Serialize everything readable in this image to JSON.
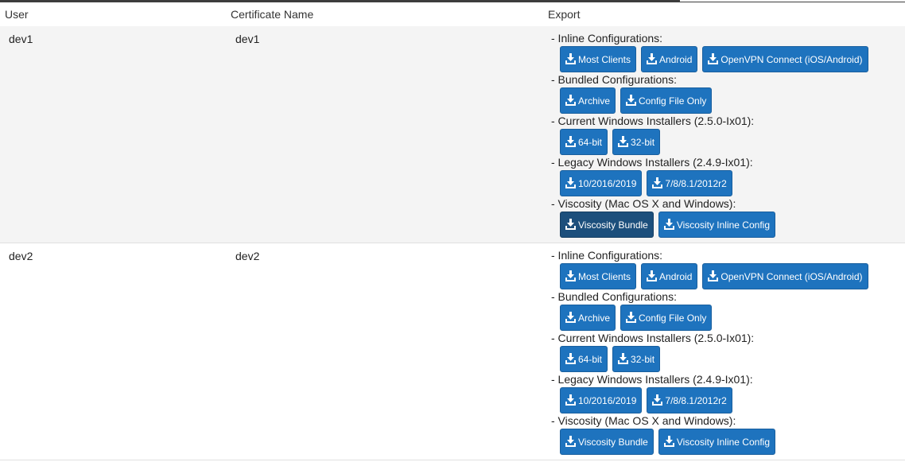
{
  "table": {
    "headers": {
      "user": "User",
      "certificate": "Certificate Name",
      "export": "Export"
    },
    "rows": [
      {
        "user": "dev1",
        "certificate": "dev1",
        "sections": [
          {
            "label": "- Inline Configurations:",
            "buttons": [
              "Most Clients",
              "Android",
              "OpenVPN Connect (iOS/Android)"
            ]
          },
          {
            "label": "- Bundled Configurations:",
            "buttons": [
              "Archive",
              "Config File Only"
            ]
          },
          {
            "label": "- Current Windows Installers (2.5.0-Ix01):",
            "buttons": [
              "64-bit",
              "32-bit"
            ]
          },
          {
            "label": "- Legacy Windows Installers (2.4.9-Ix01):",
            "buttons": [
              "10/2016/2019",
              "7/8/8.1/2012r2"
            ]
          },
          {
            "label": "- Viscosity (Mac OS X and Windows):",
            "buttons": [
              "Viscosity Bundle",
              "Viscosity Inline Config"
            ]
          }
        ]
      },
      {
        "user": "dev2",
        "certificate": "dev2",
        "sections": [
          {
            "label": "- Inline Configurations:",
            "buttons": [
              "Most Clients",
              "Android",
              "OpenVPN Connect (iOS/Android)"
            ]
          },
          {
            "label": "- Bundled Configurations:",
            "buttons": [
              "Archive",
              "Config File Only"
            ]
          },
          {
            "label": "- Current Windows Installers (2.5.0-Ix01):",
            "buttons": [
              "64-bit",
              "32-bit"
            ]
          },
          {
            "label": "- Legacy Windows Installers (2.4.9-Ix01):",
            "buttons": [
              "10/2016/2019",
              "7/8/8.1/2012r2"
            ]
          },
          {
            "label": "- Viscosity (Mac OS X and Windows):",
            "buttons": [
              "Viscosity Bundle",
              "Viscosity Inline Config"
            ]
          }
        ]
      }
    ]
  },
  "icons": {
    "button_icon": "download-icon"
  },
  "colors": {
    "button": "#1e73be",
    "button_active": "#1c4f7c",
    "row_alt": "#f4f4f4"
  }
}
